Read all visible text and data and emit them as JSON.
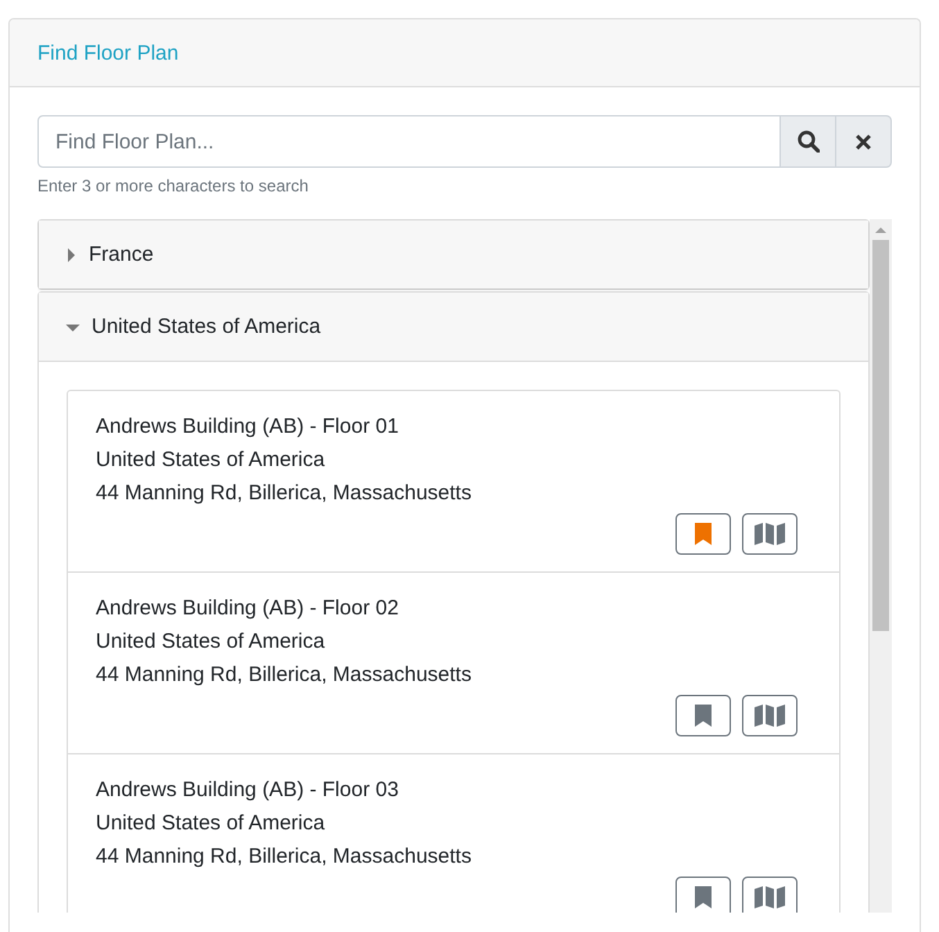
{
  "panel": {
    "title": "Find Floor Plan"
  },
  "search": {
    "placeholder": "Find Floor Plan...",
    "hint": "Enter 3 or more characters to search"
  },
  "countries": [
    {
      "name": "France",
      "expanded": false
    },
    {
      "name": "United States of America",
      "expanded": true,
      "floors": [
        {
          "name": "Andrews Building (AB) - Floor 01",
          "country": "United States of America",
          "address": "44 Manning Rd, Billerica, Massachusetts",
          "bookmarked": true
        },
        {
          "name": "Andrews Building (AB) - Floor 02",
          "country": "United States of America",
          "address": "44 Manning Rd, Billerica, Massachusetts",
          "bookmarked": false
        },
        {
          "name": "Andrews Building (AB) - Floor 03",
          "country": "United States of America",
          "address": "44 Manning Rd, Billerica, Massachusetts",
          "bookmarked": false
        }
      ]
    }
  ]
}
